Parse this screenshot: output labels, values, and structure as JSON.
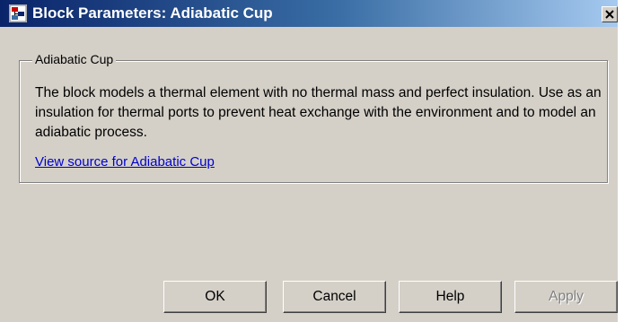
{
  "window": {
    "title": "Block Parameters: Adiabatic Cup",
    "close_symbol": "×"
  },
  "group": {
    "legend": "Adiabatic Cup",
    "description": "The block models a thermal element with no thermal mass and perfect insulation. Use as an insulation for thermal ports to prevent heat exchange with the environment and to model an adiabatic process.",
    "link": "View source for Adiabatic Cup"
  },
  "buttons": {
    "ok": "OK",
    "cancel": "Cancel",
    "help": "Help",
    "apply": "Apply"
  },
  "icons": {
    "app": "simulink-block-icon",
    "close": "close-icon"
  },
  "colors": {
    "titlebar_start": "#0a246a",
    "titlebar_end": "#a6caf0",
    "dialog_bg": "#d4d0c8",
    "link": "#0000cc",
    "disabled_text": "#808080"
  }
}
